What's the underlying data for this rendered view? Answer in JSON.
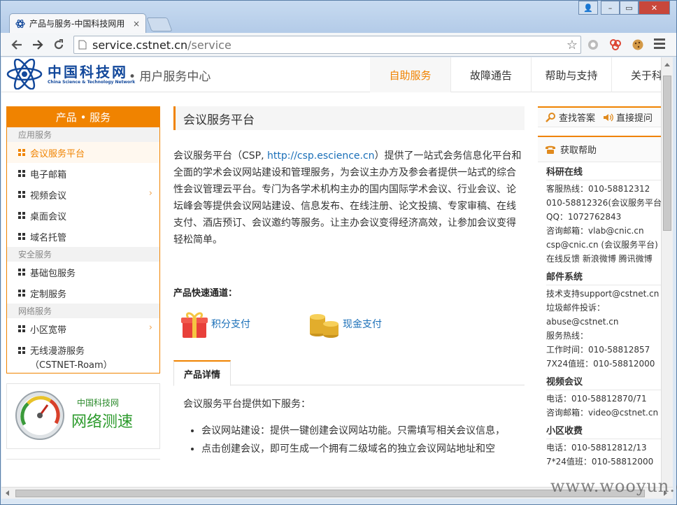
{
  "browser": {
    "tab_title": "产品与服务-中国科技网用",
    "tab_close": "×",
    "url_host": "service.cstnet.cn",
    "url_path": "/service",
    "window_user": "👤",
    "window_min": "–",
    "window_max": "▭",
    "window_close": "✕"
  },
  "site": {
    "logo_cn": "中国科技网",
    "logo_en": "China Science & Technology Network",
    "user_center": "• 用户服务中心",
    "nav": [
      "自助服务",
      "故障通告",
      "帮助与支持",
      "关于科技"
    ]
  },
  "sidebar": {
    "header": "产品 • 服务",
    "groups": [
      {
        "label": "应用服务"
      },
      {
        "label": "安全服务"
      },
      {
        "label": "网络服务"
      }
    ],
    "items": [
      "会议服务平台",
      "电子邮箱",
      "视频会议",
      "桌面会议",
      "域名托管",
      "基础包服务",
      "定制服务",
      "小区宽带",
      "无线漫游服务",
      "（CSTNET-Roam）"
    ],
    "speed_title": "中国科技网",
    "speed_subtitle": "网络测速"
  },
  "main": {
    "title": "会议服务平台",
    "intro_a": "会议服务平台（CSP, ",
    "intro_link": "http://csp.escience.cn",
    "intro_b": "）提供了一站式会务信息化平台和全面的学术会议网站建设和管理服务，为会议主办方及参会者提供一站式的综合性会议管理云平台。专门为各学术机构主办的国内国际学术会议、行业会议、论坛峰会等提供会议网站建设、信息发布、在线注册、论文投搞、专家审稿、在线支付、酒店预订、会议邀约等服务。让主办会议变得经济高效，让参加会议变得轻松简单。",
    "quick_title": "产品快速通道：",
    "quick_points": "积分支付",
    "quick_cash": "现金支付",
    "detail_tab": "产品详情",
    "detail_intro": "会议服务平台提供如下服务：",
    "detail_items": [
      "会议网站建设：提供一键创建会议网站功能。只需填写相关会议信息，",
      "点击创建会议，即可生成一个拥有二级域名的独立会议网站地址和空"
    ]
  },
  "right": {
    "find_answer": "查找答案",
    "ask": "直接提问",
    "get_help": "获取帮助",
    "sections": [
      {
        "title": "科研在线",
        "lines": [
          "客服热线：010-58812312",
          "010-58812326(会议服务平台)",
          "QQ：1072762843",
          "咨询邮箱：vlab@cnic.cn",
          "csp@cnic.cn (会议服务平台)",
          "在线反馈  新浪微博  腾讯微博"
        ]
      },
      {
        "title": "邮件系统",
        "lines": [
          "技术支持support@cstnet.cn",
          "垃圾邮件投诉：",
          "abuse@cstnet.cn",
          "服务热线：",
          "工作时间：010-58812857",
          "7X24值班：010-58812000"
        ]
      },
      {
        "title": "视频会议",
        "lines": [
          "电话：010-58812870/71",
          "咨询邮箱：video@cstnet.cn"
        ]
      },
      {
        "title": "小区收费",
        "lines": [
          "电话：010-58812812/13",
          "7*24值班：010-58812000"
        ]
      }
    ]
  },
  "watermark": "www.wooyun.org",
  "colors": {
    "accent": "#f08300",
    "link": "#1a6fb8",
    "logo": "#12489b"
  }
}
